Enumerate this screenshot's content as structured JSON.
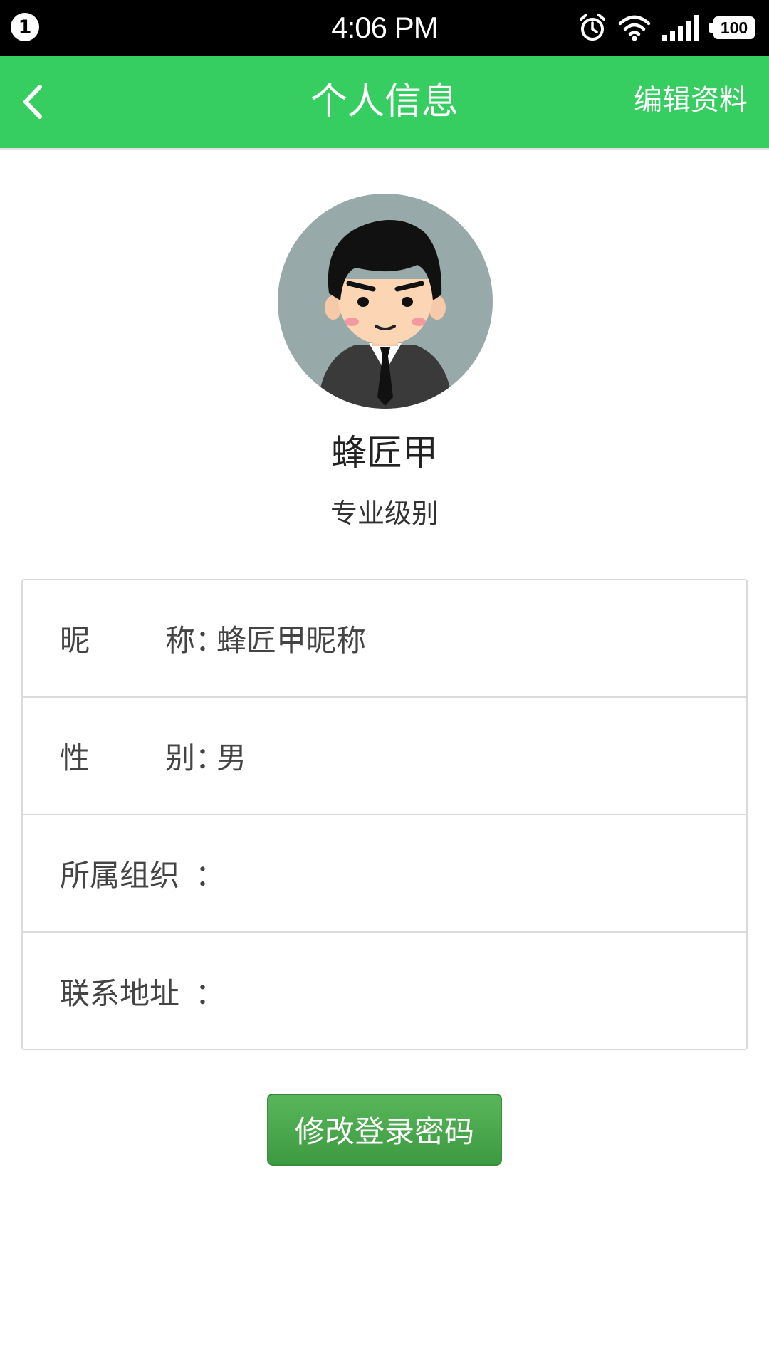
{
  "status_bar": {
    "notification_count": "1",
    "time": "4:06 PM",
    "battery_level": "100",
    "icons": [
      "alarm-icon",
      "wifi-icon",
      "signal-icon",
      "battery-icon"
    ]
  },
  "app_bar": {
    "back_icon": "chevron-left-icon",
    "title": "个人信息",
    "edit_label": "编辑资料",
    "background_color": "#36cd61"
  },
  "profile": {
    "name": "蜂匠甲",
    "level": "专业级别"
  },
  "info": {
    "rows": [
      {
        "label_start": "昵",
        "label_end": "称",
        "colon": "：",
        "value": "蜂匠甲昵称"
      },
      {
        "label_start": "性",
        "label_end": "别",
        "colon": "：",
        "value": "男"
      },
      {
        "label_start": "所属组织",
        "label_end": "",
        "colon": "：",
        "value": ""
      },
      {
        "label_start": "联系地址",
        "label_end": "",
        "colon": "：",
        "value": ""
      }
    ]
  },
  "actions": {
    "change_password_label": "修改登录密码",
    "button_color": "#4caa4f"
  }
}
